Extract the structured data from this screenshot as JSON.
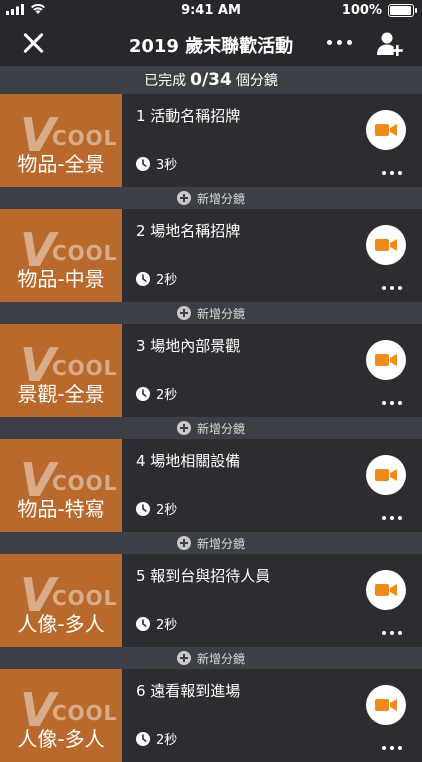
{
  "status": {
    "time": "9:41 AM",
    "battery": "100%"
  },
  "nav": {
    "title": "2019 歲末聯歡活動"
  },
  "progress": {
    "prefix": "已完成",
    "count": "0/34",
    "suffix": "個分鏡"
  },
  "add_shot_label": "新增分鏡",
  "logo": {
    "v": "V",
    "cool": "COOL"
  },
  "colors": {
    "accent": "#f08a1c",
    "thumb_bg": "#b8692b"
  },
  "shots": [
    {
      "label": "物品-全景",
      "title": "1 活動名稱招牌",
      "duration": "3秒"
    },
    {
      "label": "物品-中景",
      "title": "2 場地名稱招牌",
      "duration": "2秒"
    },
    {
      "label": "景觀-全景",
      "title": "3 場地內部景觀",
      "duration": "2秒"
    },
    {
      "label": "物品-特寫",
      "title": "4 場地相關設備",
      "duration": "2秒"
    },
    {
      "label": "人像-多人",
      "title": "5 報到台與招待人員",
      "duration": "2秒"
    },
    {
      "label": "人像-多人",
      "title": "6 遠看報到進場",
      "duration": "2秒"
    }
  ]
}
